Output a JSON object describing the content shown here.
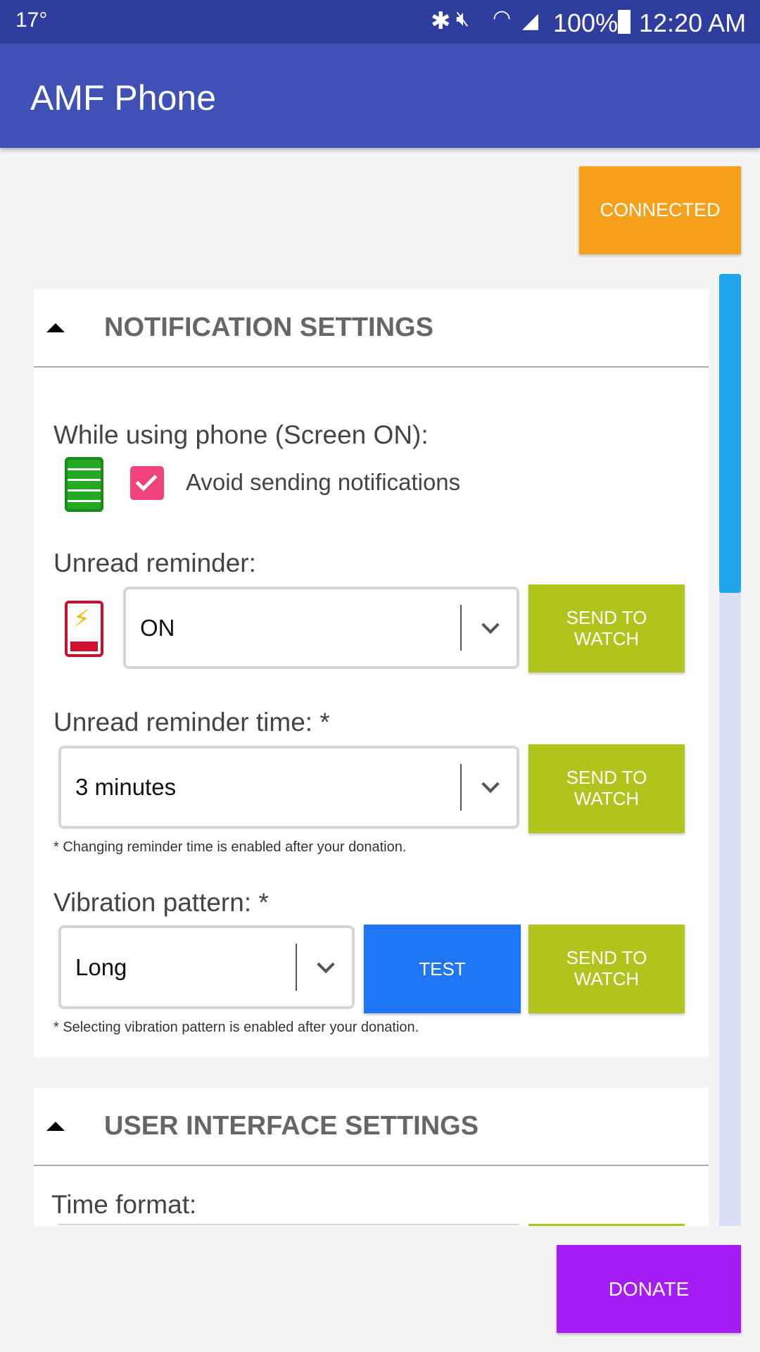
{
  "status_bar": {
    "temperature": "17°",
    "battery": "100%",
    "time": "12:20 AM",
    "icons": [
      "bluetooth-icon",
      "mute-vibrate-icon",
      "wifi-icon",
      "signal-icon",
      "battery-icon"
    ]
  },
  "app_bar": {
    "title": "AMF Phone"
  },
  "connection_button": {
    "label": "CONNECTED",
    "color": "#f5a11c"
  },
  "notification_section": {
    "title": "NOTIFICATION SETTINGS",
    "screen_on_label": "While using phone (Screen ON):",
    "avoid_checkbox": {
      "label": "Avoid sending notifications",
      "checked": true,
      "color": "#f0437a"
    },
    "unread_reminder": {
      "label": "Unread reminder:",
      "value": "ON",
      "send_label": "SEND TO WATCH"
    },
    "reminder_time": {
      "label": "Unread reminder time: *",
      "value": "3 minutes",
      "send_label": "SEND TO WATCH",
      "note": "* Changing reminder time is enabled after your donation."
    },
    "vibration": {
      "label": "Vibration pattern: *",
      "value": "Long",
      "test_label": "TEST",
      "send_label": "SEND TO WATCH",
      "note": "* Selecting vibration pattern is enabled after your donation."
    }
  },
  "ui_section": {
    "title": "USER INTERFACE SETTINGS",
    "time_format_label": "Time format:"
  },
  "donate_button": {
    "label": "DONATE",
    "color": "#a51cf5"
  },
  "scroll": {
    "position_fraction": 0.0,
    "thumb_color": "#1ea5eb"
  }
}
